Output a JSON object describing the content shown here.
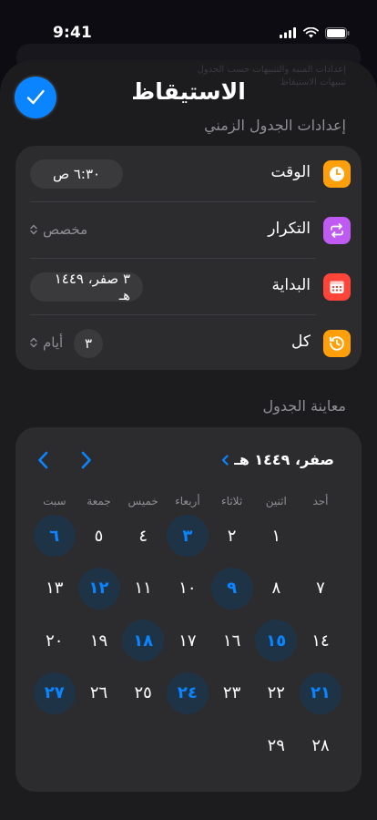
{
  "status_bar": {
    "time": "9:41"
  },
  "background": {
    "text_line1": "إعدادات المنبه والتنبيهات حسب الجدول",
    "text_line2": "تنبيهات الاستيقاظ"
  },
  "header": {
    "title": "الاستيقاظ",
    "confirm_icon": "checkmark-icon"
  },
  "schedule_settings": {
    "section_title": "إعدادات الجدول الزمني",
    "time": {
      "label": "الوقت",
      "value": "٦:٣٠ ص",
      "icon": "clock-icon",
      "color": "#ff9f0a"
    },
    "repeat": {
      "label": "التكرار",
      "value": "مخصص",
      "icon": "repeat-icon",
      "color": "#bf5af2"
    },
    "start": {
      "label": "البداية",
      "value": "٣ صفر، ١٤٤٩ هـ",
      "icon": "calendar-icon",
      "color": "#ff453a"
    },
    "every": {
      "label": "كل",
      "count": "٣",
      "unit": "أيام",
      "icon": "history-icon",
      "color": "#ff9f0a"
    }
  },
  "preview": {
    "section_title": "معاينة الجدول",
    "month_label": "صفر، ١٤٤٩ هـ",
    "weekdays": [
      "أحد",
      "اثنين",
      "ثلاثاء",
      "أربعاء",
      "خميس",
      "جمعة",
      "سبت"
    ],
    "days": [
      {
        "n": "١",
        "row": 0,
        "col": 1
      },
      {
        "n": "٢",
        "row": 0,
        "col": 2
      },
      {
        "n": "٣",
        "row": 0,
        "col": 3,
        "hl": true
      },
      {
        "n": "٤",
        "row": 0,
        "col": 4
      },
      {
        "n": "٥",
        "row": 0,
        "col": 5
      },
      {
        "n": "٦",
        "row": 0,
        "col": 6,
        "hl": true
      },
      {
        "n": "٧",
        "row": 1,
        "col": 0
      },
      {
        "n": "٨",
        "row": 1,
        "col": 1
      },
      {
        "n": "٩",
        "row": 1,
        "col": 2,
        "hl": true
      },
      {
        "n": "١٠",
        "row": 1,
        "col": 3
      },
      {
        "n": "١١",
        "row": 1,
        "col": 4
      },
      {
        "n": "١٢",
        "row": 1,
        "col": 5,
        "hl": true
      },
      {
        "n": "١٣",
        "row": 1,
        "col": 6
      },
      {
        "n": "١٤",
        "row": 2,
        "col": 0
      },
      {
        "n": "١٥",
        "row": 2,
        "col": 1,
        "hl": true
      },
      {
        "n": "١٦",
        "row": 2,
        "col": 2
      },
      {
        "n": "١٧",
        "row": 2,
        "col": 3
      },
      {
        "n": "١٨",
        "row": 2,
        "col": 4,
        "hl": true
      },
      {
        "n": "١٩",
        "row": 2,
        "col": 5
      },
      {
        "n": "٢٠",
        "row": 2,
        "col": 6
      },
      {
        "n": "٢١",
        "row": 3,
        "col": 0,
        "hl": true
      },
      {
        "n": "٢٢",
        "row": 3,
        "col": 1
      },
      {
        "n": "٢٣",
        "row": 3,
        "col": 2
      },
      {
        "n": "٢٤",
        "row": 3,
        "col": 3,
        "hl": true
      },
      {
        "n": "٢٥",
        "row": 3,
        "col": 4
      },
      {
        "n": "٢٦",
        "row": 3,
        "col": 5
      },
      {
        "n": "٢٧",
        "row": 3,
        "col": 6,
        "hl": true
      },
      {
        "n": "٢٨",
        "row": 4,
        "col": 0
      },
      {
        "n": "٢٩",
        "row": 4,
        "col": 1
      }
    ],
    "highlight_color": "#0a84ff"
  }
}
